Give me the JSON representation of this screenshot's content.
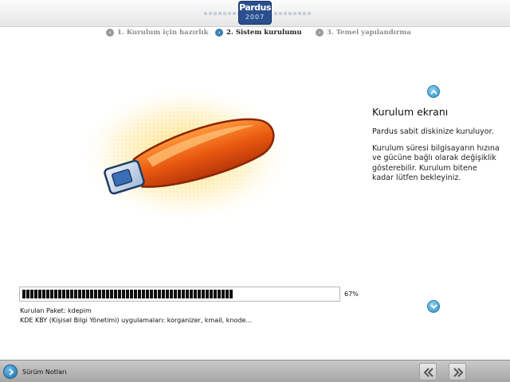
{
  "header": {
    "logo_brand": "Pardus",
    "logo_year": "2007"
  },
  "steps": [
    {
      "label": "1. Kurulum için hazırlık",
      "state": "done"
    },
    {
      "label": "2. Sistem kurulumu",
      "state": "active"
    },
    {
      "label": "3. Temel yapılandırma",
      "state": "pending"
    }
  ],
  "info": {
    "title": "Kurulum ekranı",
    "paragraph1": "Pardus sabit diskinize kuruluyor.",
    "paragraph2": "Kurulum süresi bilgisayarın hızına ve gücüne bağlı olarak değişiklik gösterebilir. Kurulum bitene kadar lütfen bekleyiniz.",
    "scroll_up_icon": "chevron-up-icon",
    "scroll_down_icon": "chevron-down-icon"
  },
  "progress": {
    "value": 0.67,
    "label": "67%"
  },
  "package": {
    "current": "Kurulan Paket: kdepim",
    "description": "KDE KBY (Kişisel Bilgi Yönetimi) uygulamaları: korganizer, kmail, knode..."
  },
  "footer": {
    "release_notes_label": "Sürüm Notları",
    "back_icon": "double-chevron-left-icon",
    "next_icon": "double-chevron-right-icon"
  },
  "colors": {
    "accent": "#3d7fb0",
    "usb_body": "#e8570f",
    "usb_cap": "#3a6fb8",
    "footer": "#b5b5b5"
  }
}
